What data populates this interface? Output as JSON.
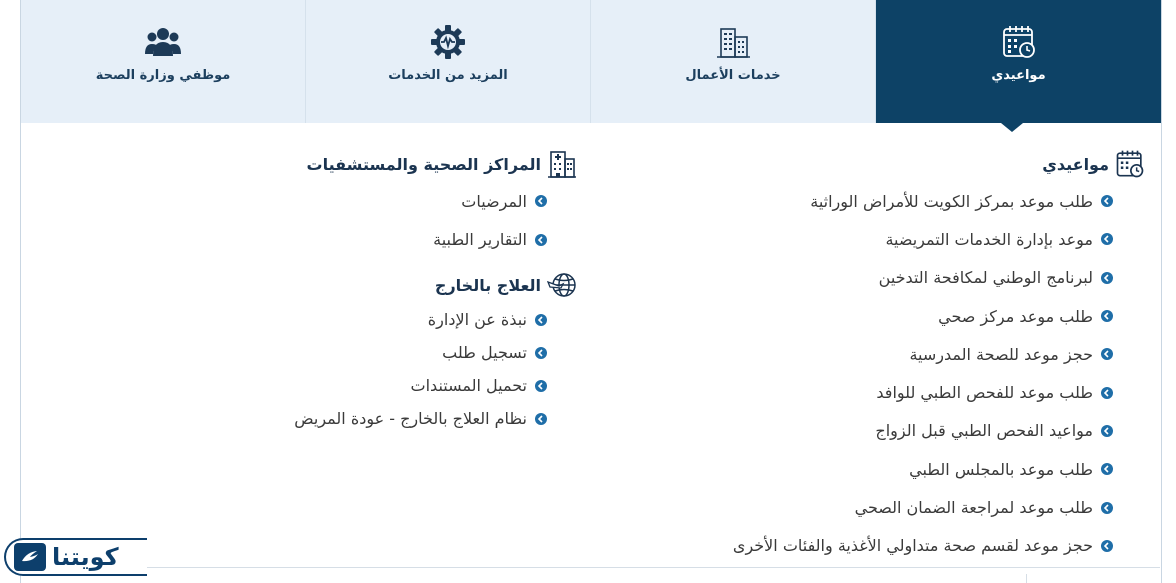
{
  "tabs": [
    {
      "label": "موظفي وزارة الصحة",
      "icon": "users-icon",
      "active": false
    },
    {
      "label": "المزيد من الخدمات",
      "icon": "gear-icon",
      "active": false
    },
    {
      "label": "خدمات الأعمال",
      "icon": "building-icon",
      "active": false
    },
    {
      "label": "مواعيدي",
      "icon": "calendar-clock-icon",
      "active": true
    }
  ],
  "appointments": {
    "heading": "مواعيدي",
    "items": [
      "طلب موعد بمركز الكويت للأمراض الوراثية",
      "موعد بإدارة الخدمات التمريضية",
      "لبرنامج الوطني لمكافحة التدخين",
      "طلب موعد مركز صحي",
      "حجز موعد للصحة المدرسية",
      "طلب موعد للفحص الطبي للوافد",
      "مواعيد الفحص الطبي قبل الزواج",
      "طلب موعد بالمجلس الطبي",
      "طلب موعد لمراجعة الضمان الصحي",
      "حجز موعد لقسم صحة متداولي الأغذية والفئات الأخرى"
    ]
  },
  "health_centers": {
    "heading": "المراكز الصحية والمستشفيات",
    "items": [
      "المرضيات",
      "التقارير الطبية"
    ]
  },
  "abroad": {
    "heading": "العلاج بالخارج",
    "items": [
      "نبذة عن الإدارة",
      "تسجيل طلب",
      "تحميل المستندات",
      "نظام العلاج بالخارج - عودة المريض"
    ]
  },
  "logo": {
    "text": "كويتنا"
  },
  "colors": {
    "active_tab": "#0d4266",
    "tab_bg": "#e6eff8",
    "bullet": "#1f6ea8",
    "heading": "#1b3450"
  }
}
